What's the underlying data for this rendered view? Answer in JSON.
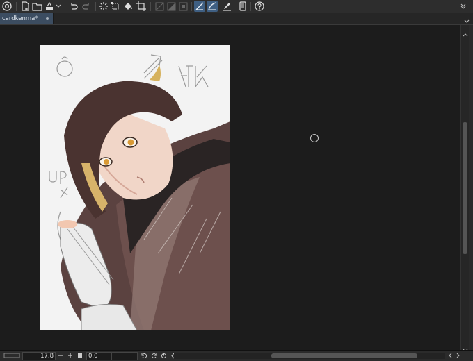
{
  "colors": {
    "toolbar_bg": "#2d2d2d",
    "active_tool_bg": "#3f5f82",
    "tab_active_bg": "#3c4d61",
    "workspace_bg": "#1c1c1c",
    "canvas_bg": "#f3f3f3"
  },
  "toolbar": {
    "buttons": [
      {
        "icon": "app-logo-icon"
      },
      {
        "icon": "new-file-icon"
      },
      {
        "icon": "open-folder-icon"
      },
      {
        "icon": "save-icon"
      },
      {
        "icon": "dropdown-chevron-icon"
      },
      {
        "icon": "undo-icon"
      },
      {
        "icon": "redo-icon"
      },
      {
        "icon": "loading-spinner-icon"
      },
      {
        "icon": "transform-icon"
      },
      {
        "icon": "fill-bucket-icon"
      },
      {
        "icon": "crop-icon"
      },
      {
        "icon": "select-none-icon"
      },
      {
        "icon": "invert-selection-icon"
      },
      {
        "icon": "selection-border-icon"
      },
      {
        "icon": "ruler-snap-icon"
      },
      {
        "icon": "curve-snap-icon"
      },
      {
        "icon": "pen-ruler-icon"
      },
      {
        "icon": "device-icon"
      },
      {
        "icon": "help-icon"
      }
    ]
  },
  "document": {
    "tab_title": "cardkenma*"
  },
  "status": {
    "zoom": "17.8",
    "rotation": "0.0"
  }
}
